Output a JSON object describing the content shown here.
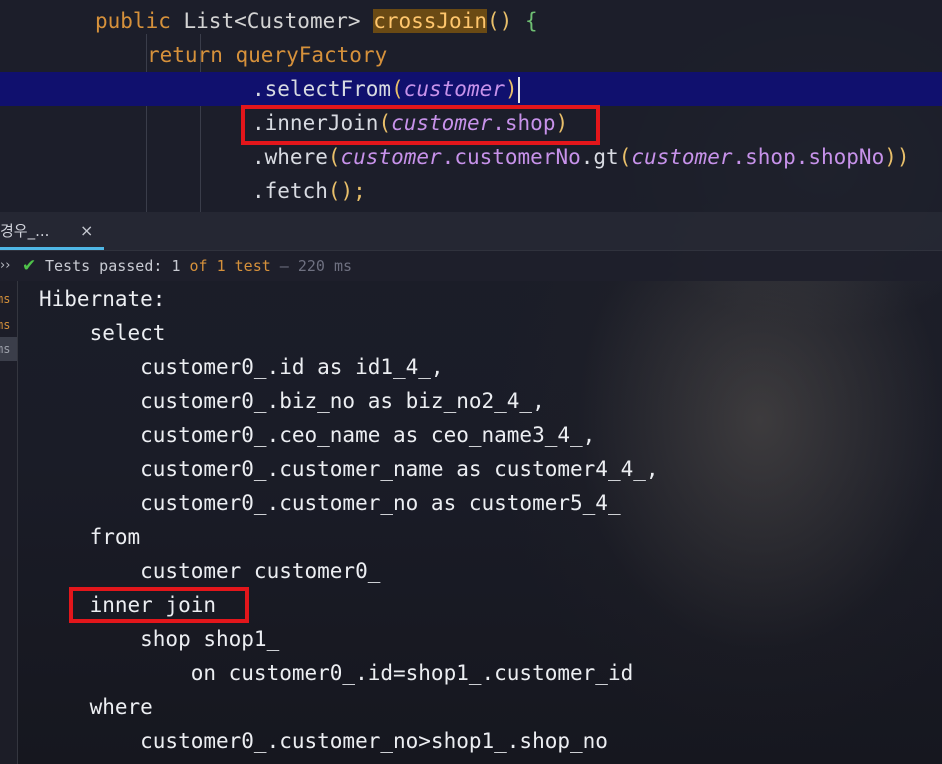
{
  "editor": {
    "lines": {
      "l1": {
        "public": "public",
        "type": "List<Customer>",
        "method": "crossJoin",
        "parens": "()",
        "brace": "{"
      },
      "l2": {
        "return": "return",
        "factory": "queryFactory"
      },
      "l3": {
        "dot": ".selectFrom",
        "open": "(",
        "arg": "customer",
        "close": ")"
      },
      "l4": {
        "dot": ".innerJoin",
        "open": "(",
        "arg": "customer",
        "field": ".shop",
        "close": ")"
      },
      "l5": {
        "dot": ".where",
        "open": "(",
        "arg": "customer",
        "field1": ".customerNo",
        "gt": ".gt",
        "open2": "(",
        "arg2": "customer",
        "field2": ".shop",
        "field3": ".shopNo",
        "close": "))"
      },
      "l6": {
        "dot": ".fetch",
        "call": "();"
      }
    }
  },
  "run_panel": {
    "tab_label": "경우_...",
    "tab_close": "×",
    "status": {
      "chevron": "››",
      "check_icon": "check-icon",
      "prefix": "Tests passed: ",
      "passed": "1",
      "of": " of ",
      "total": "1 test",
      "sep": " – ",
      "duration": "220 ms"
    },
    "left_strip": [
      "ms",
      "ms",
      "ms"
    ]
  },
  "console": {
    "lines": [
      "Hibernate: ",
      "    select",
      "        customer0_.id as id1_4_,",
      "        customer0_.biz_no as biz_no2_4_,",
      "        customer0_.ceo_name as ceo_name3_4_,",
      "        customer0_.customer_name as customer4_4_,",
      "        customer0_.customer_no as customer5_4_ ",
      "    from",
      "        customer customer0_ ",
      "    inner join",
      "        shop shop1_ ",
      "            on customer0_.id=shop1_.customer_id ",
      "    where",
      "        customer0_.customer_no>shop1_.shop_no"
    ]
  },
  "colors": {
    "highlight_box": "#e3161b",
    "selected_line": "#10106e",
    "keyword": "#d6913b",
    "field": "#c792ea",
    "pass_check": "#4fc24a"
  }
}
